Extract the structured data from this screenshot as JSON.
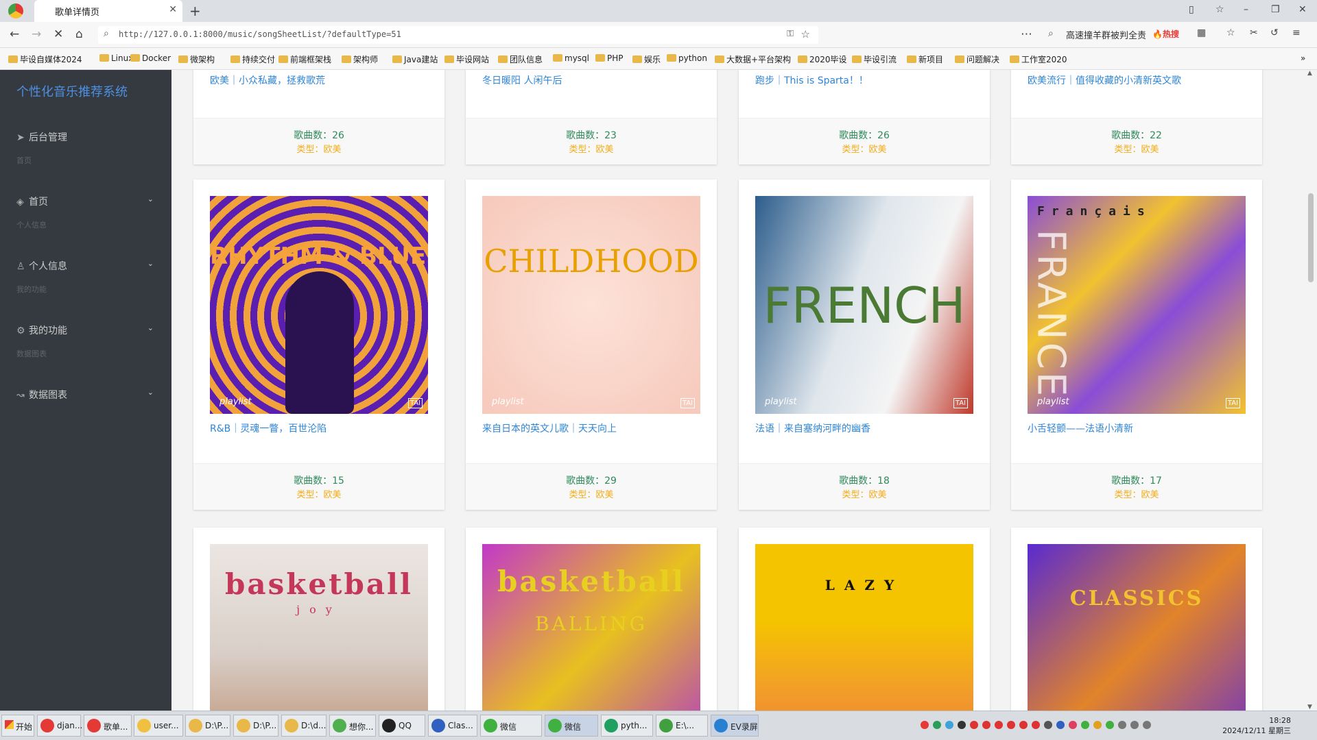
{
  "browser": {
    "tab_title": "歌单详情页",
    "url": "http://127.0.0.1:8000/music/songSheetList/?defaultType=51",
    "search_text": "高速撞羊群被判全责",
    "search_badge": "🔥热搜",
    "bookmarks": [
      "毕设自媒体2024",
      "Linux",
      "Docker",
      "微架构",
      "持续交付",
      "前端框架栈",
      "架构师",
      "Java建站",
      "毕设网站",
      "团队信息",
      "mysql",
      "PHP",
      "娱乐",
      "python",
      "大数据+平台架构",
      "2020毕设",
      "毕设引流",
      "新项目",
      "问题解决",
      "工作室2020"
    ]
  },
  "sidebar": {
    "brand": "个性化音乐推荐系统",
    "items": [
      {
        "type": "item",
        "label": "后台管理",
        "icon": "send-icon",
        "chev": false
      },
      {
        "type": "section",
        "label": "首页"
      },
      {
        "type": "item",
        "label": "首页",
        "icon": "layers-icon",
        "chev": true
      },
      {
        "type": "section",
        "label": "个人信息"
      },
      {
        "type": "item",
        "label": "个人信息",
        "icon": "user-icon",
        "chev": true
      },
      {
        "type": "section",
        "label": "我的功能"
      },
      {
        "type": "item",
        "label": "我的功能",
        "icon": "gear-icon",
        "chev": true
      },
      {
        "type": "section",
        "label": "数据图表"
      },
      {
        "type": "item",
        "label": "数据图表",
        "icon": "trend-icon",
        "chev": true
      }
    ]
  },
  "cards_top": [
    {
      "title": "欧美｜小众私藏，拯救歌荒",
      "count": "歌曲数：26",
      "type": "类型：欧美"
    },
    {
      "title": "冬日暖阳 人闲午后",
      "count": "歌曲数：23",
      "type": "类型：欧美"
    },
    {
      "title": "跑步｜This is Sparta！！",
      "count": "歌曲数：26",
      "type": "类型：欧美"
    },
    {
      "title": "欧美流行｜值得收藏的小清新英文歌",
      "count": "歌曲数：22",
      "type": "类型：欧美"
    }
  ],
  "cards_mid": [
    {
      "title": "R&B｜灵魂一瞥，百世沦陷",
      "count": "歌曲数：15",
      "type": "类型：欧美",
      "cover_text": "RHYTHM & BLUES",
      "playlist": "playlist"
    },
    {
      "title": "来自日本的英文儿歌｜天天向上",
      "count": "歌曲数：29",
      "type": "类型：欧美",
      "cover_text": "CHILDHOOD",
      "playlist": "playlist"
    },
    {
      "title": "法语｜来自塞纳河畔的幽香",
      "count": "歌曲数：18",
      "type": "类型：欧美",
      "cover_text": "FRENCH",
      "playlist": "playlist"
    },
    {
      "title": "小舌轻颤——法语小清新",
      "count": "歌曲数：17",
      "type": "类型：欧美",
      "cover_text": "Français",
      "cover_text2": "FRANCE",
      "playlist": "playlist"
    }
  ],
  "cards_bottom": [
    {
      "cover_text": "basketball",
      "sub": "joy"
    },
    {
      "cover_text": "basketball",
      "sub": "BALLING"
    },
    {
      "cover_text": "LAZY"
    },
    {
      "cover_text": "CLASSICS"
    }
  ],
  "taskbar": {
    "start": "开始",
    "items": [
      "djan...",
      "歌单...",
      "user...",
      "D:\\P...",
      "D:\\P...",
      "D:\\d...",
      "想你...",
      "QQ",
      "Clas...",
      "微信",
      "微信",
      "pyth...",
      "E:\\...",
      "EV录屏"
    ],
    "time": "18:28",
    "date": "2024/12/11 星期三"
  }
}
